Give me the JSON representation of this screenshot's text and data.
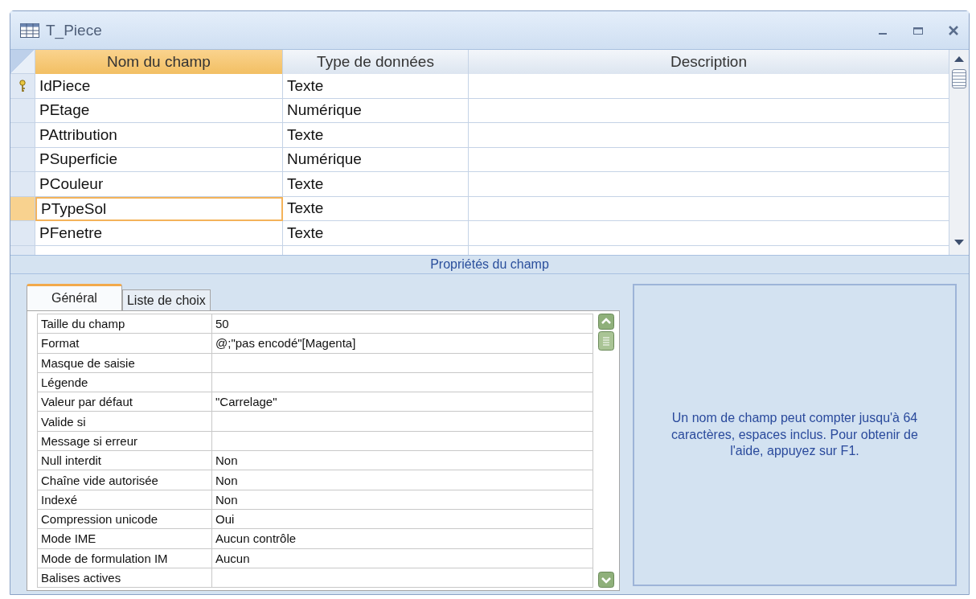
{
  "window": {
    "title": "T_Piece"
  },
  "fields_table": {
    "columns": [
      "Nom du champ",
      "Type de données",
      "Description"
    ],
    "rows": [
      {
        "name": "IdPiece",
        "type": "Texte",
        "primary_key": true,
        "selected": false
      },
      {
        "name": "PEtage",
        "type": "Numérique",
        "primary_key": false,
        "selected": false
      },
      {
        "name": "PAttribution",
        "type": "Texte",
        "primary_key": false,
        "selected": false
      },
      {
        "name": "PSuperficie",
        "type": "Numérique",
        "primary_key": false,
        "selected": false
      },
      {
        "name": "PCouleur",
        "type": "Texte",
        "primary_key": false,
        "selected": false
      },
      {
        "name": "PTypeSol",
        "type": "Texte",
        "primary_key": false,
        "selected": true
      },
      {
        "name": "PFenetre",
        "type": "Texte",
        "primary_key": false,
        "selected": false
      }
    ]
  },
  "properties_bar": {
    "title": "Propriétés du champ"
  },
  "tabs": [
    {
      "label": "Général",
      "selected": true
    },
    {
      "label": "Liste de choix",
      "selected": false
    }
  ],
  "properties": [
    {
      "label": "Taille du champ",
      "value": "50"
    },
    {
      "label": "Format",
      "value": "@;\"pas encodé\"[Magenta]"
    },
    {
      "label": "Masque de saisie"
    },
    {
      "label": "Légende"
    },
    {
      "label": "Valeur par défaut",
      "value": "\"Carrelage\""
    },
    {
      "label": "Valide si"
    },
    {
      "label": "Message si erreur"
    },
    {
      "label": "Null interdit",
      "value": "Non"
    },
    {
      "label": "Chaîne vide autorisée",
      "value": "Non"
    },
    {
      "label": "Indexé",
      "value": "Non"
    },
    {
      "label": "Compression unicode",
      "value": "Oui"
    },
    {
      "label": "Mode IME",
      "value": "Aucun contrôle"
    },
    {
      "label": "Mode de formulation IM",
      "value": "Aucun"
    },
    {
      "label": "Balises actives"
    }
  ],
  "help": {
    "text": "Un nom de champ peut compter jusqu'à 64 caractères, espaces inclus. Pour obtenir de l'aide, appuyez sur F1."
  }
}
